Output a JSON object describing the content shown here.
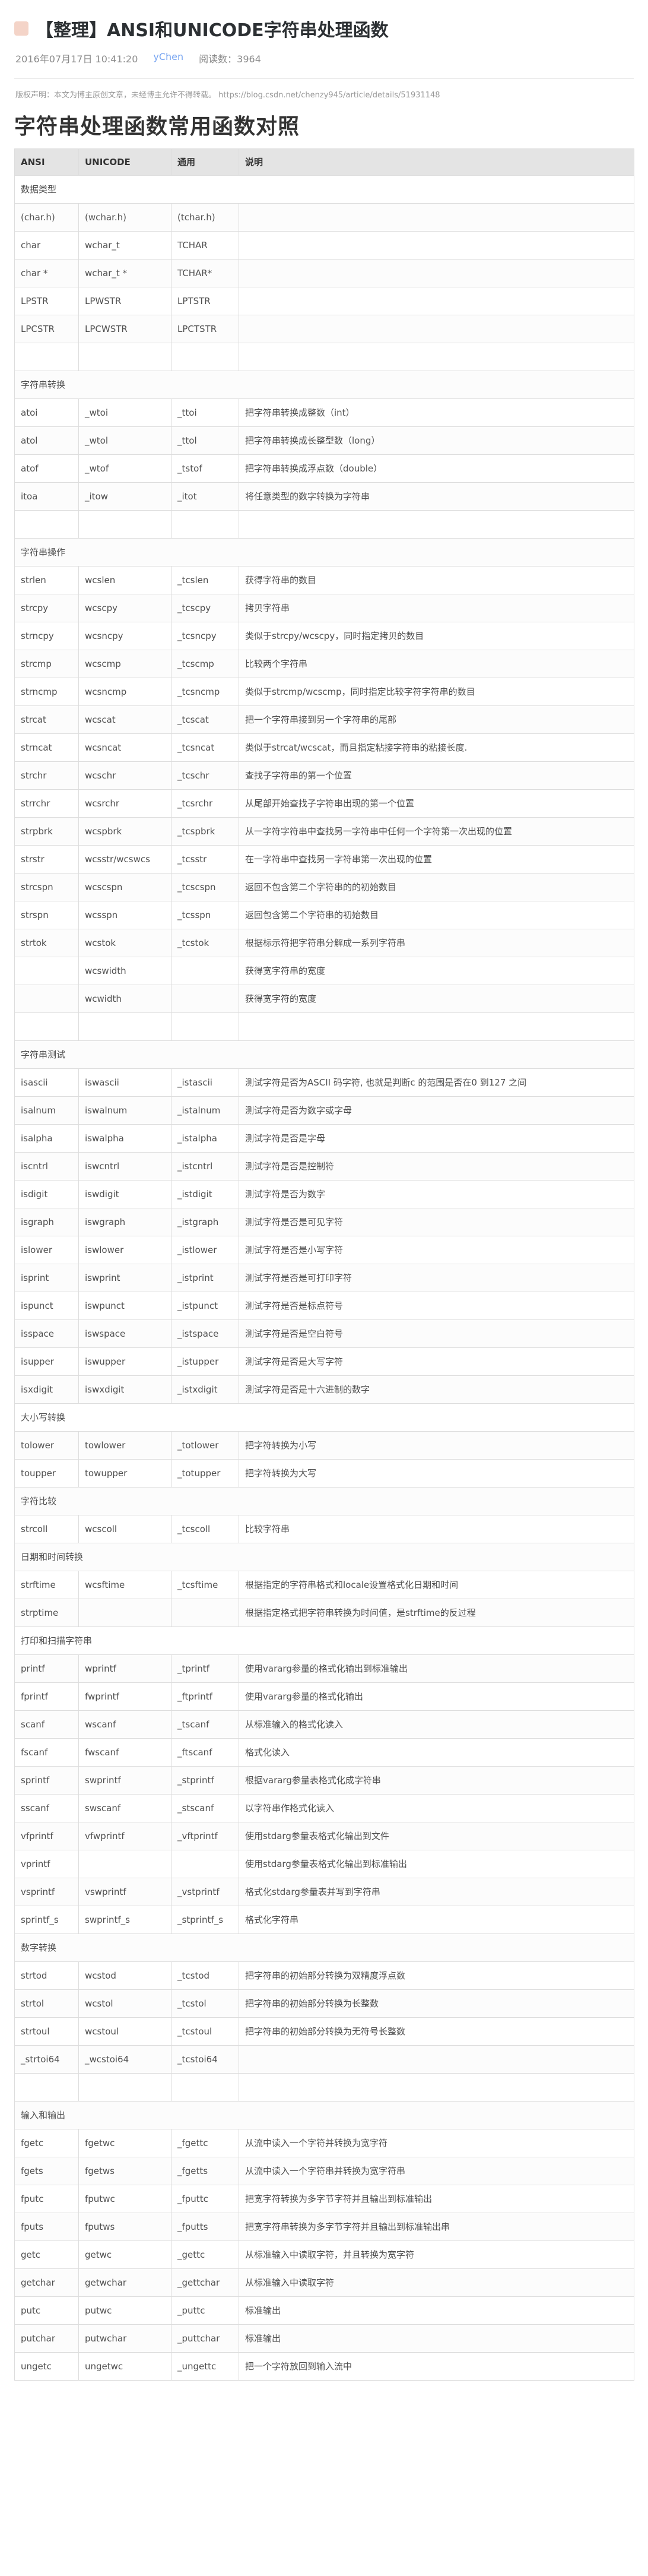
{
  "article": {
    "title": "【整理】ANSI和UNICODE字符串处理函数",
    "date": "2016年07月17日 10:41:20",
    "author": "yChen",
    "reads": "阅读数：3964",
    "copyright_text": "版权声明：本文为博主原创文章，未经博主允许不得转载。",
    "copyright_url": "https://blog.csdn.net/chenzy945/article/details/51931148",
    "heading": "字符串处理函数常用函数对照"
  },
  "table": {
    "headers": [
      "ANSI",
      "UNICODE",
      "通用",
      "说明"
    ],
    "rows": [
      {
        "type": "section",
        "label": "数据类型"
      },
      {
        "cells": [
          "(char.h)",
          "(wchar.h)",
          "(tchar.h)",
          ""
        ]
      },
      {
        "cells": [
          "char",
          "wchar_t",
          "TCHAR",
          ""
        ]
      },
      {
        "cells": [
          "char *",
          "wchar_t *",
          "TCHAR*",
          ""
        ]
      },
      {
        "cells": [
          "LPSTR",
          "LPWSTR",
          "LPTSTR",
          ""
        ]
      },
      {
        "cells": [
          "LPCSTR",
          "LPCWSTR",
          "LPCTSTR",
          ""
        ]
      },
      {
        "cells": [
          "",
          "",
          "",
          ""
        ]
      },
      {
        "type": "section",
        "label": "字符串转换"
      },
      {
        "cells": [
          "atoi",
          "_wtoi",
          "_ttoi",
          "把字符串转换成整数（int）"
        ]
      },
      {
        "cells": [
          "atol",
          "_wtol",
          "_ttol",
          "把字符串转换成长整型数（long）"
        ]
      },
      {
        "cells": [
          "atof",
          "_wtof",
          "_tstof",
          "把字符串转换成浮点数（double）"
        ]
      },
      {
        "cells": [
          "itoa",
          "_itow",
          "_itot",
          "将任意类型的数字转换为字符串"
        ]
      },
      {
        "cells": [
          "",
          "",
          "",
          ""
        ]
      },
      {
        "type": "section",
        "label": "字符串操作"
      },
      {
        "cells": [
          "strlen",
          "wcslen",
          "_tcslen",
          "获得字符串的数目"
        ]
      },
      {
        "cells": [
          "strcpy",
          "wcscpy",
          "_tcscpy",
          "拷贝字符串"
        ]
      },
      {
        "cells": [
          "strncpy",
          "wcsncpy",
          "_tcsncpy",
          "类似于strcpy/wcscpy，同时指定拷贝的数目"
        ]
      },
      {
        "cells": [
          "strcmp",
          "wcscmp",
          "_tcscmp",
          "比较两个字符串"
        ]
      },
      {
        "cells": [
          "strncmp",
          "wcsncmp",
          "_tcsncmp",
          "类似于strcmp/wcscmp，同时指定比较字符字符串的数目"
        ]
      },
      {
        "cells": [
          "strcat",
          "wcscat",
          "_tcscat",
          "把一个字符串接到另一个字符串的尾部"
        ]
      },
      {
        "cells": [
          "strncat",
          "wcsncat",
          "_tcsncat",
          "类似于strcat/wcscat，而且指定粘接字符串的粘接长度."
        ]
      },
      {
        "cells": [
          "strchr",
          "wcschr",
          "_tcschr",
          "查找子字符串的第一个位置"
        ]
      },
      {
        "cells": [
          "strrchr",
          "wcsrchr",
          "_tcsrchr",
          "从尾部开始查找子字符串出现的第一个位置"
        ]
      },
      {
        "cells": [
          "strpbrk",
          "wcspbrk",
          "_tcspbrk",
          "从一字符字符串中查找另一字符串中任何一个字符第一次出现的位置"
        ]
      },
      {
        "cells": [
          "strstr",
          "wcsstr/wcswcs",
          "_tcsstr",
          "在一字符串中查找另一字符串第一次出现的位置"
        ]
      },
      {
        "cells": [
          "strcspn",
          "wcscspn",
          "_tcscspn",
          "返回不包含第二个字符串的的初始数目"
        ]
      },
      {
        "cells": [
          "strspn",
          "wcsspn",
          "_tcsspn",
          "返回包含第二个字符串的初始数目"
        ]
      },
      {
        "cells": [
          "strtok",
          "wcstok",
          "_tcstok",
          "根据标示符把字符串分解成一系列字符串"
        ]
      },
      {
        "cells": [
          "",
          "wcswidth",
          "",
          "获得宽字符串的宽度"
        ]
      },
      {
        "cells": [
          "",
          "wcwidth",
          "",
          "获得宽字符的宽度"
        ]
      },
      {
        "cells": [
          "",
          "",
          "",
          ""
        ]
      },
      {
        "type": "section",
        "label": "字符串测试"
      },
      {
        "cells": [
          "isascii",
          "iswascii",
          "_istascii",
          "测试字符是否为ASCII 码字符, 也就是判断c 的范围是否在0 到127 之间"
        ]
      },
      {
        "cells": [
          "isalnum",
          "iswalnum",
          "_istalnum",
          "测试字符是否为数字或字母"
        ]
      },
      {
        "cells": [
          "isalpha",
          "iswalpha",
          "_istalpha",
          "测试字符是否是字母"
        ]
      },
      {
        "cells": [
          "iscntrl",
          "iswcntrl",
          "_istcntrl",
          "测试字符是否是控制符"
        ]
      },
      {
        "cells": [
          "isdigit",
          "iswdigit",
          "_istdigit",
          "测试字符是否为数字"
        ]
      },
      {
        "cells": [
          "isgraph",
          "iswgraph",
          "_istgraph",
          "测试字符是否是可见字符"
        ]
      },
      {
        "cells": [
          "islower",
          "iswlower",
          "_istlower",
          "测试字符是否是小写字符"
        ]
      },
      {
        "cells": [
          "isprint",
          "iswprint",
          "_istprint",
          "测试字符是否是可打印字符"
        ]
      },
      {
        "cells": [
          "ispunct",
          "iswpunct",
          "_istpunct",
          "测试字符是否是标点符号"
        ]
      },
      {
        "cells": [
          "isspace",
          "iswspace",
          "_istspace",
          "测试字符是否是空白符号"
        ]
      },
      {
        "cells": [
          "isupper",
          "iswupper",
          "_istupper",
          "测试字符是否是大写字符"
        ]
      },
      {
        "cells": [
          "isxdigit",
          "iswxdigit",
          "_istxdigit",
          "测试字符是否是十六进制的数字"
        ]
      },
      {
        "type": "section",
        "label": "大小写转换"
      },
      {
        "cells": [
          "tolower",
          "towlower",
          "_totlower",
          "把字符转换为小写"
        ]
      },
      {
        "cells": [
          "toupper",
          "towupper",
          "_totupper",
          "把字符转换为大写"
        ]
      },
      {
        "type": "section",
        "label": "字符比较"
      },
      {
        "cells": [
          "strcoll",
          "wcscoll",
          "_tcscoll",
          "比较字符串"
        ]
      },
      {
        "type": "section",
        "label": "日期和时间转换"
      },
      {
        "cells": [
          "strftime",
          "wcsftime",
          "_tcsftime",
          "根据指定的字符串格式和locale设置格式化日期和时间"
        ]
      },
      {
        "cells": [
          "strptime",
          "",
          "",
          "根据指定格式把字符串转换为时间值，是strftime的反过程"
        ]
      },
      {
        "type": "section",
        "label": "打印和扫描字符串"
      },
      {
        "cells": [
          "printf",
          "wprintf",
          "_tprintf",
          "使用vararg参量的格式化输出到标准输出"
        ]
      },
      {
        "cells": [
          "fprintf",
          "fwprintf",
          "_ftprintf",
          "使用vararg参量的格式化输出"
        ]
      },
      {
        "cells": [
          "scanf",
          "wscanf",
          "_tscanf",
          "从标准输入的格式化读入"
        ]
      },
      {
        "cells": [
          "fscanf",
          "fwscanf",
          "_ftscanf",
          "格式化读入"
        ]
      },
      {
        "cells": [
          "sprintf",
          "swprintf",
          "_stprintf",
          "根据vararg参量表格式化成字符串"
        ]
      },
      {
        "cells": [
          "sscanf",
          "swscanf",
          "_stscanf",
          "以字符串作格式化读入"
        ]
      },
      {
        "cells": [
          "vfprintf",
          "vfwprintf",
          "_vftprintf",
          "使用stdarg参量表格式化输出到文件"
        ]
      },
      {
        "cells": [
          "vprintf",
          "",
          "",
          "使用stdarg参量表格式化输出到标准输出"
        ]
      },
      {
        "cells": [
          "vsprintf",
          "vswprintf",
          "_vstprintf",
          "格式化stdarg参量表并写到字符串"
        ]
      },
      {
        "cells": [
          "sprintf_s",
          "swprintf_s",
          "_stprintf_s",
          "格式化字符串"
        ]
      },
      {
        "type": "section",
        "label": "数字转换"
      },
      {
        "cells": [
          "strtod",
          "wcstod",
          "_tcstod",
          "把字符串的初始部分转换为双精度浮点数"
        ]
      },
      {
        "cells": [
          "strtol",
          "wcstol",
          "_tcstol",
          "把字符串的初始部分转换为长整数"
        ]
      },
      {
        "cells": [
          "strtoul",
          "wcstoul",
          "_tcstoul",
          "把字符串的初始部分转换为无符号长整数"
        ]
      },
      {
        "cells": [
          "_strtoi64",
          "_wcstoi64",
          "_tcstoi64",
          ""
        ]
      },
      {
        "cells": [
          "",
          "",
          "",
          ""
        ]
      },
      {
        "type": "section",
        "label": "输入和输出"
      },
      {
        "cells": [
          "fgetc",
          "fgetwc",
          "_fgettc",
          "从流中读入一个字符并转换为宽字符"
        ]
      },
      {
        "cells": [
          "fgets",
          "fgetws",
          "_fgetts",
          "从流中读入一个字符串并转换为宽字符串"
        ]
      },
      {
        "cells": [
          "fputc",
          "fputwc",
          "_fputtc",
          "把宽字符转换为多字节字符并且输出到标准输出"
        ]
      },
      {
        "cells": [
          "fputs",
          "fputws",
          "_fputts",
          "把宽字符串转换为多字节字符并且输出到标准输出串"
        ]
      },
      {
        "cells": [
          "getc",
          "getwc",
          "_gettc",
          "从标准输入中读取字符，并且转换为宽字符"
        ]
      },
      {
        "cells": [
          "getchar",
          "getwchar",
          "_gettchar",
          "从标准输入中读取字符"
        ]
      },
      {
        "cells": [
          "putc",
          "putwc",
          "_puttc",
          "标准输出"
        ]
      },
      {
        "cells": [
          "putchar",
          "putwchar",
          "_puttchar",
          "标准输出"
        ]
      },
      {
        "cells": [
          "ungetc",
          "ungetwc",
          "_ungettc",
          "把一个字符放回到输入流中"
        ]
      }
    ]
  }
}
